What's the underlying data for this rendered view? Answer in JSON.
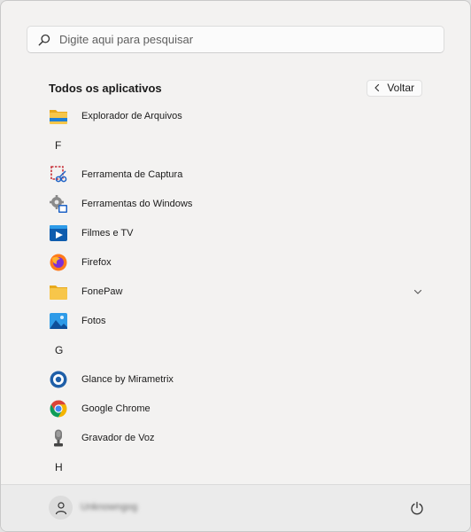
{
  "search": {
    "placeholder": "Digite aqui para pesquisar",
    "icon": "search-icon"
  },
  "header": {
    "title": "Todos os aplicativos",
    "back_label": "Voltar"
  },
  "apps": [
    {
      "type": "app",
      "label": "Explorador de Arquivos",
      "icon": "file-explorer-icon"
    },
    {
      "type": "letter",
      "label": "F"
    },
    {
      "type": "app",
      "label": "Ferramenta de Captura",
      "icon": "snipping-tool-icon"
    },
    {
      "type": "app",
      "label": "Ferramentas do Windows",
      "icon": "windows-tools-icon"
    },
    {
      "type": "app",
      "label": "Filmes e TV",
      "icon": "movies-tv-icon"
    },
    {
      "type": "app",
      "label": "Firefox",
      "icon": "firefox-icon"
    },
    {
      "type": "app",
      "label": "FonePaw",
      "icon": "folder-icon",
      "expandable": true
    },
    {
      "type": "app",
      "label": "Fotos",
      "icon": "photos-icon"
    },
    {
      "type": "letter",
      "label": "G"
    },
    {
      "type": "app",
      "label": "Glance by Mirametrix",
      "icon": "glance-icon"
    },
    {
      "type": "app",
      "label": "Google Chrome",
      "icon": "chrome-icon"
    },
    {
      "type": "app",
      "label": "Gravador de Voz",
      "icon": "voice-recorder-icon"
    },
    {
      "type": "letter",
      "label": "H"
    }
  ],
  "user": {
    "name": "Unknowngog"
  },
  "colors": {
    "accent": "#0067c0",
    "background": "#f3f2f1",
    "footer": "#ebebeb"
  }
}
